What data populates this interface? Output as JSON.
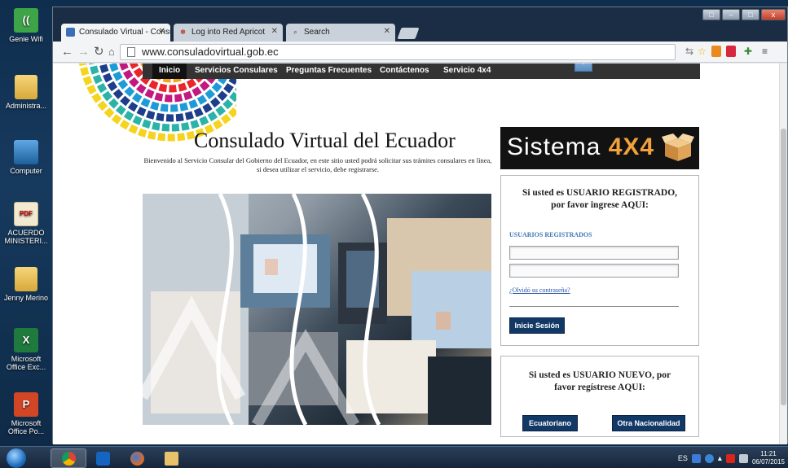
{
  "desktop": {
    "icons": [
      {
        "label": "Genie Wifi",
        "glyph": "((",
        "icon": "wifi-icon"
      },
      {
        "label": "Administra...",
        "glyph": "",
        "icon": "folder-icon"
      },
      {
        "label": "Computer",
        "glyph": "",
        "icon": "computer-icon"
      },
      {
        "label": "ACUERDO MINISTERI...",
        "glyph": "PDF",
        "icon": "pdf-icon"
      },
      {
        "label": "Jenny Merino",
        "glyph": "",
        "icon": "folder-icon"
      },
      {
        "label": "Microsoft Office Exc...",
        "glyph": "X",
        "icon": "excel-icon"
      },
      {
        "label": "Microsoft Office Po...",
        "glyph": "P",
        "icon": "powerpoint-icon"
      }
    ]
  },
  "browser": {
    "tabs": [
      {
        "title": "Consulado Virtual - Consu",
        "icon": "site-favicon",
        "active": true
      },
      {
        "title": "Log into Red Apricot",
        "icon": "apricot-favicon",
        "active": false
      },
      {
        "title": "Search",
        "icon": "search-icon",
        "active": false
      }
    ],
    "url": "www.consuladovirtual.gob.ec",
    "window_buttons": {
      "min": "–",
      "max": "□",
      "close": "x"
    }
  },
  "site": {
    "nav": [
      "Inicio",
      "Servicios Consulares",
      "Preguntas Frecuentes",
      "Contáctenos",
      "Servicio 4x4"
    ],
    "title": "Consulado Virtual del Ecuador",
    "intro": "Bienvenido al Servicio Consular del Gobierno del Ecuador, en este sitio usted podrá solicitar sus trámites consulares en línea, si desea utilizar el servicio, debe registrarse.",
    "banner": {
      "prefix": "Sistema ",
      "highlight": "4X4"
    },
    "login": {
      "heading_line1": "Si usted es USUARIO REGISTRADO,",
      "heading_line2": "por favor ingrese AQUI:",
      "section_label": "USUARIOS REGISTRADOS",
      "forgot": "¿Olvidó su contraseña?",
      "button": "Inicie Sesión"
    },
    "register": {
      "heading_line1": "Si usted es USUARIO NUEVO, por",
      "heading_line2": "favor regístrese AQUI:",
      "button_ecuatoriano": "Ecuatoriano",
      "button_otra": "Otra Nacionalidad"
    }
  },
  "taskbar": {
    "lang": "ES",
    "time": "11:21",
    "date": "06/07/2015"
  },
  "colors": {
    "nav_bg": "#333333",
    "button_navy": "#123866",
    "link_blue": "#2857a8",
    "banner_accent": "#f1a23a"
  }
}
